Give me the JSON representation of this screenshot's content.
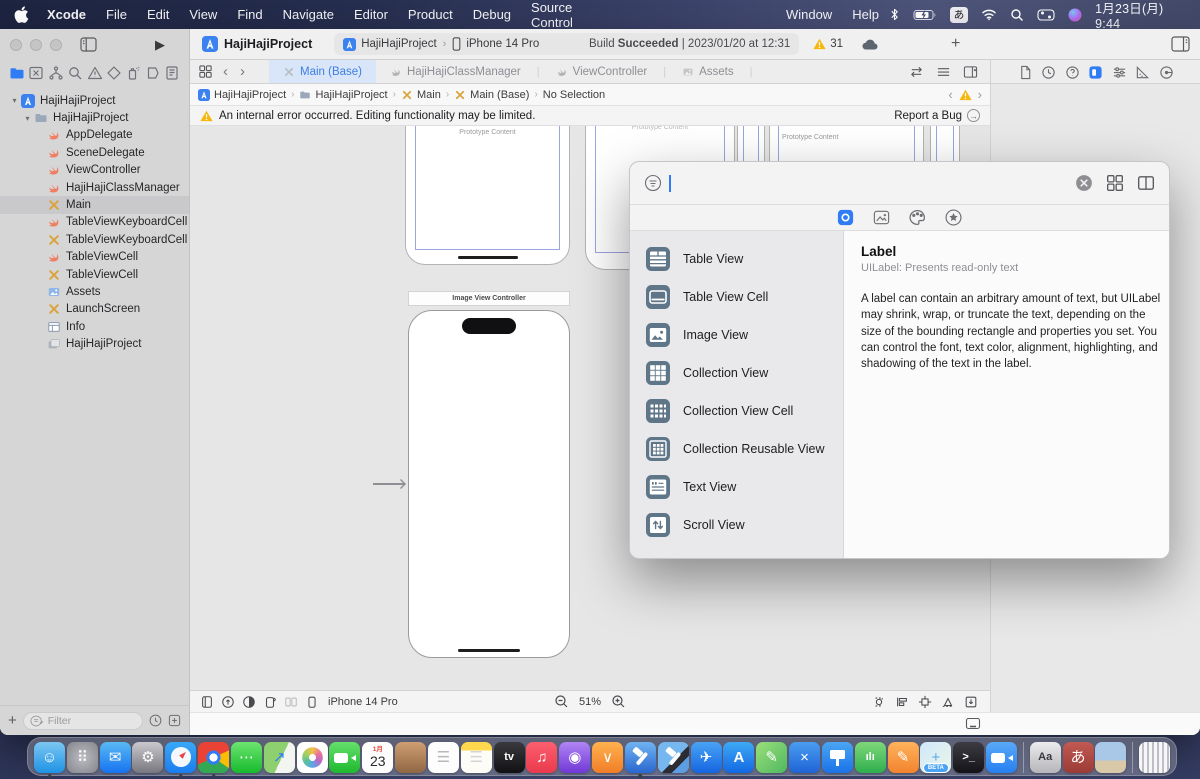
{
  "menu_bar": {
    "apps": [
      "Xcode",
      "File",
      "Edit",
      "View",
      "Find",
      "Navigate",
      "Editor",
      "Product",
      "Debug",
      "Source Control"
    ],
    "window_menus": [
      "Window",
      "Help"
    ],
    "ime_badge": "あ",
    "clock": "1月23日(月) 9:44"
  },
  "toolbar": {
    "project": "HajiHajiProject",
    "scheme": "HajiHajiProject",
    "destination": "iPhone 14 Pro",
    "build_label": "Build",
    "build_status": "Succeeded",
    "build_time": "| 2023/01/20 at 12:31",
    "warning_count": "31",
    "plus": "+"
  },
  "tab_bar": {
    "tabs": [
      {
        "label": "Main (Base)",
        "icon": "storyboard",
        "active": true
      },
      {
        "label": "HajiHajiClassManager",
        "icon": "swift"
      },
      {
        "label": "ViewController",
        "icon": "swift"
      },
      {
        "label": "Assets",
        "icon": "assets"
      }
    ]
  },
  "breadcrumb": {
    "items": [
      {
        "label": "HajiHajiProject",
        "icon": "project"
      },
      {
        "label": "HajiHajiProject",
        "icon": "folder"
      },
      {
        "label": "Main",
        "icon": "storyboard"
      },
      {
        "label": "Main (Base)",
        "icon": "storyboard"
      },
      {
        "label": "No Selection"
      }
    ]
  },
  "banner": {
    "message": "An internal error occurred. Editing functionality may be limited.",
    "action": "Report a Bug"
  },
  "navigator": {
    "filter_placeholder": "Filter",
    "items": [
      {
        "label": "HajiHajiProject",
        "icon": "project",
        "indent": 0,
        "chevron": true
      },
      {
        "label": "HajiHajiProject",
        "icon": "folder",
        "indent": 1,
        "chevron": true
      },
      {
        "label": "AppDelegate",
        "icon": "swift",
        "indent": 2
      },
      {
        "label": "SceneDelegate",
        "icon": "swift",
        "indent": 2
      },
      {
        "label": "ViewController",
        "icon": "swift",
        "indent": 2
      },
      {
        "label": "HajiHajiClassManager",
        "icon": "swift",
        "indent": 2
      },
      {
        "label": "Main",
        "icon": "storyboard",
        "indent": 2,
        "selected": true
      },
      {
        "label": "TableViewKeyboardCell",
        "icon": "swift",
        "indent": 2
      },
      {
        "label": "TableViewKeyboardCell",
        "icon": "storyboard",
        "indent": 2
      },
      {
        "label": "TableViewCell",
        "icon": "swift",
        "indent": 2
      },
      {
        "label": "TableViewCell",
        "icon": "storyboard",
        "indent": 2
      },
      {
        "label": "Assets",
        "icon": "assets",
        "indent": 2
      },
      {
        "label": "LaunchScreen",
        "icon": "storyboard",
        "indent": 2
      },
      {
        "label": "Info",
        "icon": "plist",
        "indent": 2
      },
      {
        "label": "HajiHajiProject",
        "icon": "bundle",
        "indent": 2
      }
    ]
  },
  "canvas": {
    "prototype_label": "Prototype Content",
    "scene_title": "Image View Controller"
  },
  "status_bar": {
    "device": "iPhone 14 Pro",
    "zoom": "51%"
  },
  "library": {
    "items": [
      {
        "label": "Table View",
        "icon": "lib-table-view"
      },
      {
        "label": "Table View Cell",
        "icon": "lib-table-view-cell"
      },
      {
        "label": "Image View",
        "icon": "lib-image-view"
      },
      {
        "label": "Collection View",
        "icon": "lib-collection-view"
      },
      {
        "label": "Collection View Cell",
        "icon": "lib-collection-view-cell"
      },
      {
        "label": "Collection Reusable View",
        "icon": "lib-collection-reusable-view"
      },
      {
        "label": "Text View",
        "icon": "lib-text-view"
      },
      {
        "label": "Scroll View",
        "icon": "lib-scroll-view"
      }
    ],
    "detail": {
      "title": "Label",
      "subtitle": "UILabel: Presents read-only text",
      "body": "A label can contain an arbitrary amount of text, but UILabel may shrink, wrap, or truncate the text, depending on the size of the bounding rectangle and properties you set. You can control the font, text color, alignment, highlighting, and shadowing of the text in the label."
    }
  },
  "dock": {
    "calendar": {
      "month": "1月",
      "day": "23"
    },
    "items": [
      {
        "name": "finder",
        "bg": "linear-gradient(180deg,#7cc6f2,#1e93e4)",
        "glyph": "☺",
        "running": true
      },
      {
        "name": "launchpad",
        "bg": "radial-gradient(circle,#bcbdc3,#84848b)",
        "glyph": "⠿"
      },
      {
        "name": "mail",
        "bg": "linear-gradient(180deg,#59b9f3,#1673f1)",
        "glyph": "✉"
      },
      {
        "name": "system-settings",
        "bg": "linear-gradient(180deg,#c8c8cd,#77777e)",
        "glyph": "⚙"
      },
      {
        "name": "safari",
        "bg": "linear-gradient(180deg,#39a8f6,#1b7df0)",
        "shape": "compass",
        "running": true
      },
      {
        "name": "chrome",
        "bg": "radial-gradient(circle at 50% 50%, #fff 0 4px, #2f7cf6 4px 7px, transparent 7px), conic-gradient(from -45deg, #ea4335 0 110deg, #fbbc05 110deg 170deg, #34a853 170deg 290deg, #ea4335 290deg)",
        "running": true
      },
      {
        "name": "messages",
        "bg": "linear-gradient(180deg,#6ce56f,#17ba2d)",
        "glyph": "⋯"
      },
      {
        "name": "maps",
        "bg": "linear-gradient(115deg,#8ed06f 0 55%,#f3f5f0 55%)",
        "glyph": "↗",
        "glyph_color": "#2f7cf6"
      },
      {
        "name": "photos",
        "bg": "radial-gradient(circle,#fff 0 3.5px,transparent 3.5px 10px,#fff 10.5px), conic-gradient(#f3c14b,#e8739b,#b96bc6,#5aa7e8,#59c19a,#a8cf5a,#f3c14b)"
      },
      {
        "name": "facetime",
        "bg": "linear-gradient(180deg,#65e06c,#1eb82e)",
        "shape": "camera"
      },
      {
        "name": "calendar",
        "bg": "#fdfdfd",
        "type": "calendar"
      },
      {
        "name": "contacts-book",
        "bg": "linear-gradient(180deg,#cf9e72,#8f6744)"
      },
      {
        "name": "reminders",
        "bg": "#fdfdfd",
        "glyph": "☰",
        "glyph_color": "#b8b8bd"
      },
      {
        "name": "notes",
        "bg": "linear-gradient(180deg,#ffd84e 0 27%,#fdfcf7 27%)",
        "glyph": "☰",
        "glyph_color": "#d4d4d6"
      },
      {
        "name": "apple-tv",
        "bg": "linear-gradient(180deg,#3a3a3e,#111114)",
        "glyph": "tv"
      },
      {
        "name": "music",
        "bg": "linear-gradient(180deg,#fc5f6f,#e93a4d)",
        "glyph": "♫"
      },
      {
        "name": "podcasts",
        "bg": "linear-gradient(180deg,#b084f5,#7138d6)",
        "glyph": "◉"
      },
      {
        "name": "books",
        "bg": "linear-gradient(180deg,#ffb14e,#f07e28)",
        "glyph": "∨"
      },
      {
        "name": "xcode",
        "bg": "linear-gradient(180deg,#6fb3f2,#2967cf)",
        "shape": "hammer",
        "running": true
      },
      {
        "name": "xcode-beta",
        "bg": "linear-gradient(135deg,#77b7ef 0 55%,#2c2c34 55% 72%,#5d9de2 72%)",
        "shape": "hammer"
      },
      {
        "name": "testflight",
        "bg": "linear-gradient(180deg,#4aa3f5,#1565e0)",
        "glyph": "✈"
      },
      {
        "name": "app-store",
        "bg": "linear-gradient(180deg,#3fa9f5,#1268e2)",
        "glyph": "A"
      },
      {
        "name": "playgrounds",
        "bg": "linear-gradient(135deg,#9adf7a,#4fb860)",
        "glyph": "✎"
      },
      {
        "name": "blue-x-app",
        "bg": "linear-gradient(180deg,#4a9df0,#1f63d6)",
        "glyph": "×"
      },
      {
        "name": "keynote",
        "bg": "linear-gradient(180deg,#4aa6f2,#1b72e8)",
        "shape": "podium"
      },
      {
        "name": "numbers",
        "bg": "linear-gradient(180deg,#7ed87a,#2fae4e)",
        "glyph": "ılı"
      },
      {
        "name": "pages",
        "bg": "linear-gradient(180deg,#ffb35c,#f2832e)",
        "glyph": "✎"
      },
      {
        "name": "freeform-beta",
        "bg": "linear-gradient(135deg,#cfe8fb,#eaf6e6)",
        "glyph": "+",
        "glyph_color": "#5aa7e8",
        "badge": "BETA"
      },
      {
        "name": "terminal",
        "bg": "linear-gradient(180deg,#3c3c42,#131318)",
        "glyph": ">_"
      },
      {
        "name": "zoom",
        "bg": "linear-gradient(180deg,#59a9f8,#2680f0)",
        "shape": "camera"
      },
      {
        "divider": true
      },
      {
        "name": "font-book",
        "bg": "linear-gradient(180deg,#ececee,#b5b5ba)",
        "glyph": "Aa",
        "glyph_color": "#3a3a3e"
      },
      {
        "name": "japanese-ime",
        "bg": "linear-gradient(180deg,#c05a52,#9c3b36)",
        "glyph": "あ"
      },
      {
        "name": "desktop-preview",
        "bg": "linear-gradient(180deg,#a9c8e8 0 60%,#d9c9a8 60%)"
      },
      {
        "divider": true
      },
      {
        "name": "trash",
        "bg": "repeating-linear-gradient(90deg, rgba(255,255,255,.95) 0 3px, rgba(200,200,208,.9) 3px 5px)"
      }
    ]
  },
  "colors": {
    "accent": "#2f7cf6",
    "warning": "#f6b60b",
    "selection": "#c9c8ca"
  }
}
